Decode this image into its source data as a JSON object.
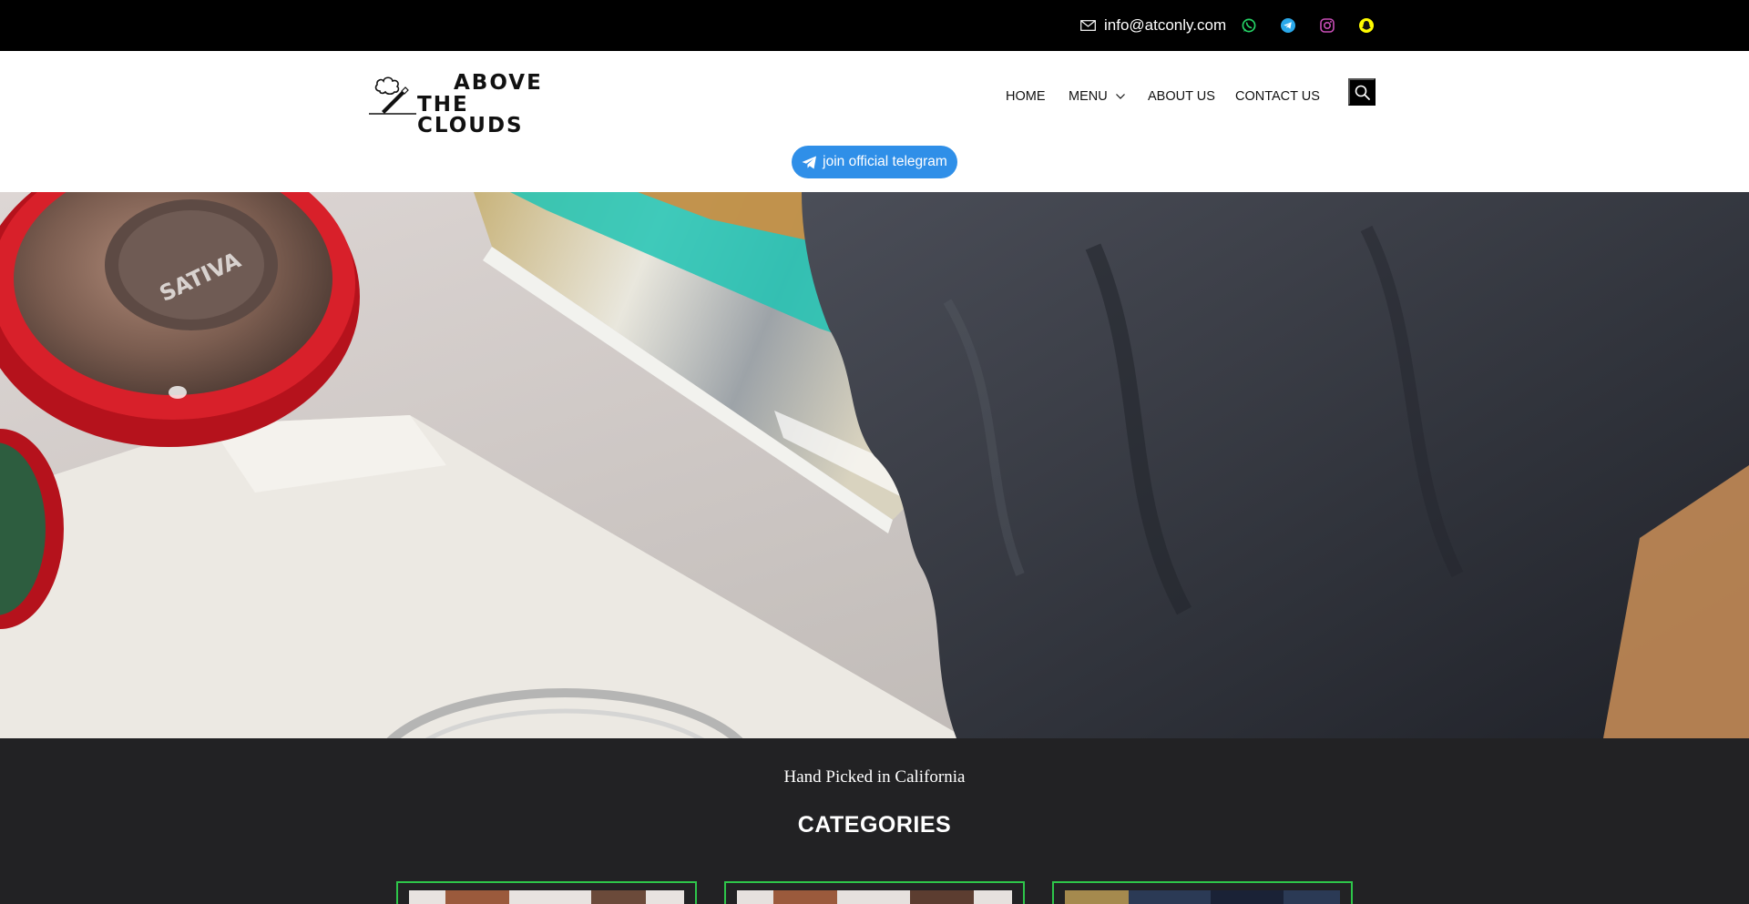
{
  "topbar": {
    "email": "info@atconly.com",
    "icons": [
      "mail-icon",
      "whatsapp-icon",
      "telegram-icon",
      "instagram-icon",
      "snapchat-icon"
    ],
    "colors": {
      "whatsapp": "#25d366",
      "telegram": "#2aa8ea",
      "instagram": "#c84db6",
      "snapchat": "#fffc00"
    }
  },
  "logo": {
    "line1": "ABOVE",
    "line2": "THE CLOUDS"
  },
  "nav": {
    "items": [
      {
        "label": "HOME"
      },
      {
        "label": "MENU"
      },
      {
        "label": "ABOUT US"
      },
      {
        "label": "CONTACT US"
      }
    ]
  },
  "cta": {
    "label": "join official telegram",
    "color": "#2f8fe8"
  },
  "section": {
    "tagline": "Hand Picked in California",
    "title": "CATEGORIES",
    "card_border_color": "#2ec64a"
  }
}
